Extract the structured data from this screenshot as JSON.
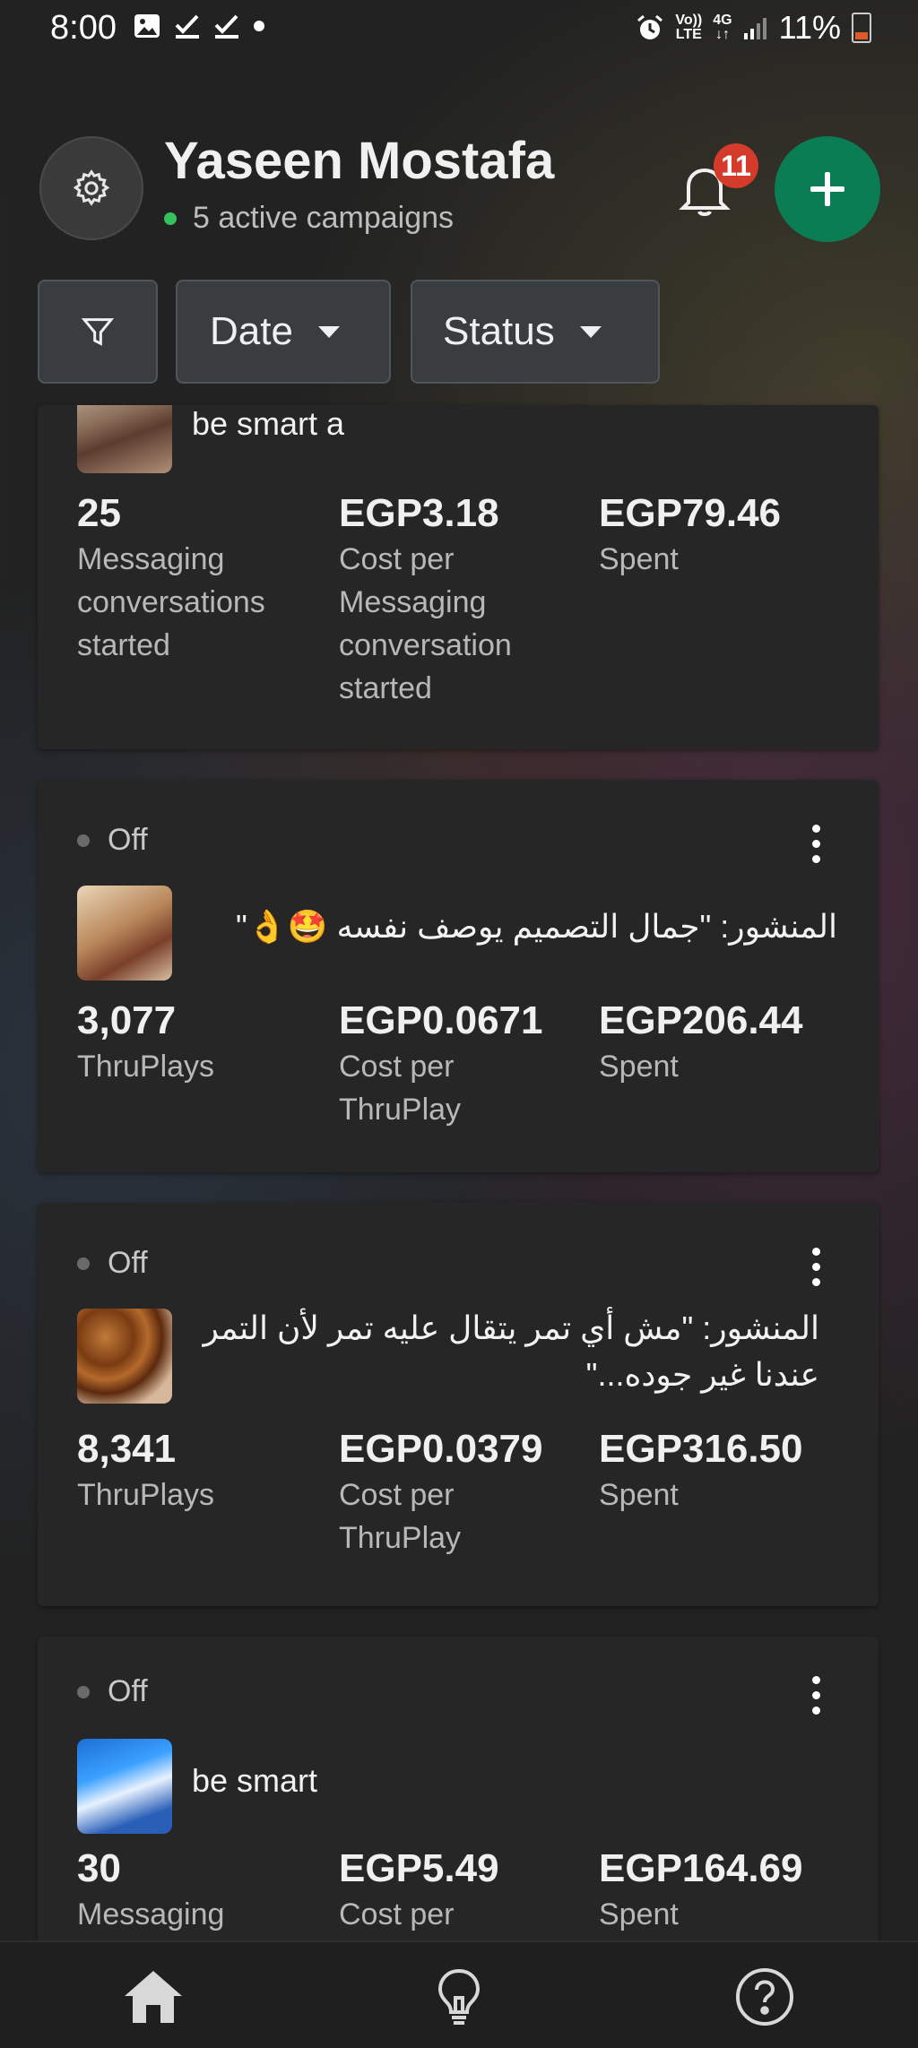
{
  "status_bar": {
    "time": "8:00",
    "left_icons": [
      "image-icon",
      "check-icon",
      "check-icon",
      "dot-icon"
    ],
    "alarm_icon": "alarm-icon",
    "volte_top": "Vo))",
    "volte_bottom": "LTE",
    "network": "4G",
    "battery": "11%"
  },
  "header": {
    "name": "Yaseen Mostafa",
    "subtitle": "5 active campaigns",
    "status_color": "#37c15c",
    "notification_count": "11",
    "add_color": "#0a7d55"
  },
  "filters": {
    "date_label": "Date",
    "status_label": "Status"
  },
  "campaigns": [
    {
      "name": "be smart a",
      "metrics": [
        {
          "value": "25",
          "label": "Messaging conversations started"
        },
        {
          "value": "EGP3.18",
          "label": "Cost per Messaging conversation started"
        },
        {
          "value": "EGP79.46",
          "label": "Spent"
        }
      ]
    },
    {
      "status": "Off",
      "name": "المنشور: \"جمال التصميم يوصف نفسه 🤩👌\"",
      "metrics": [
        {
          "value": "3,077",
          "label": "ThruPlays"
        },
        {
          "value": "EGP0.0671",
          "label": "Cost per ThruPlay"
        },
        {
          "value": "EGP206.44",
          "label": "Spent"
        }
      ]
    },
    {
      "status": "Off",
      "name": "المنشور: \"مش أي تمر يتقال عليه تمر لأن التمر عندنا غير جوده...\"",
      "metrics": [
        {
          "value": "8,341",
          "label": "ThruPlays"
        },
        {
          "value": "EGP0.0379",
          "label": "Cost per ThruPlay"
        },
        {
          "value": "EGP316.50",
          "label": "Spent"
        }
      ]
    },
    {
      "status": "Off",
      "name": "be smart",
      "metrics": [
        {
          "value": "30",
          "label": "Messaging"
        },
        {
          "value": "EGP5.49",
          "label": "Cost per"
        },
        {
          "value": "EGP164.69",
          "label": "Spent"
        }
      ]
    }
  ],
  "bottom_nav": [
    "home-icon",
    "lightbulb-icon",
    "help-icon"
  ]
}
